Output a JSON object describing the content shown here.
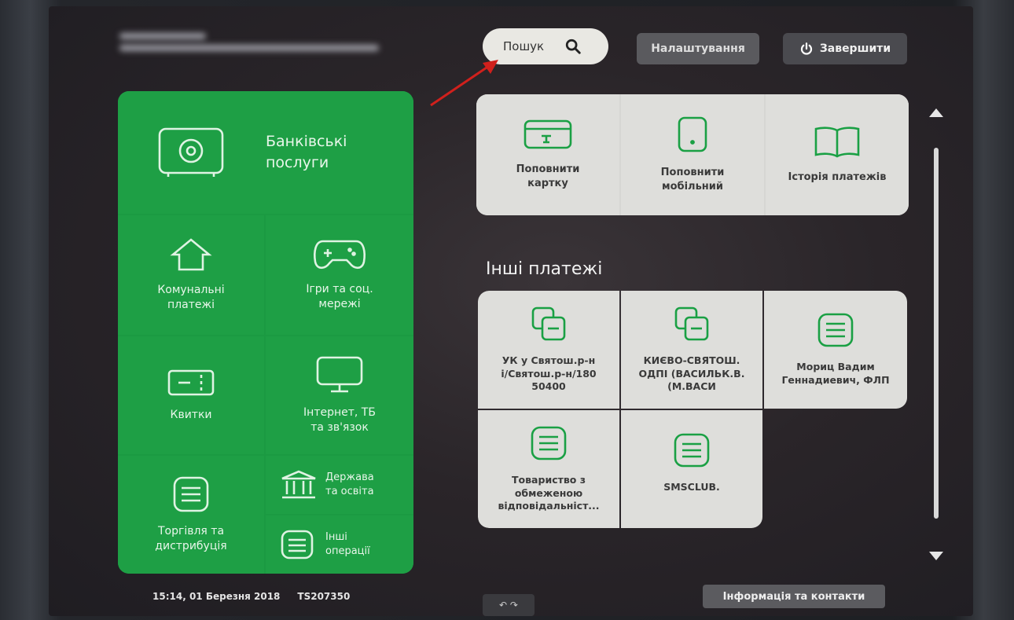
{
  "header": {
    "search_label": "Пошук",
    "settings_label": "Налаштування",
    "finish_label": "Завершити"
  },
  "categories": {
    "banking": "Банківські послуги",
    "utilities": "Комунальні платежі",
    "games": "Ігри та соц. мережі",
    "tickets": "Квитки",
    "internet": "Інтернет, ТБ та зв'язок",
    "trade": "Торгівля та дистрибуція",
    "government": "Держава та освіта",
    "other_ops": "Інші операції"
  },
  "quick_actions": {
    "topup_card": "Поповнити картку",
    "topup_mobile": "Поповнити мобільний",
    "history": "Історія платежів"
  },
  "other_payments": {
    "title": "Інші платежі",
    "items": [
      "УК у Святош.р-ні/Святош.р-н/18050400",
      "КИЄВО-СВЯТОШ. ОДПІ (ВАСИЛЬК.В.(М.ВАСИ",
      "Мориц Вадим Геннадиевич, ФЛП",
      "Товариство з обмеженою відповідальніст...",
      "SMSCLUB."
    ]
  },
  "footer": {
    "time": "15:14,",
    "date": "01 Березня 2018",
    "terminal_id": "TS207350",
    "info_label": "Інформація та контакти",
    "nav_glyphs": "↶ ↷"
  },
  "colors": {
    "brand_green": "#1e9f45",
    "tile_light": "#dededb",
    "accent_arrow": "#d0201c"
  }
}
